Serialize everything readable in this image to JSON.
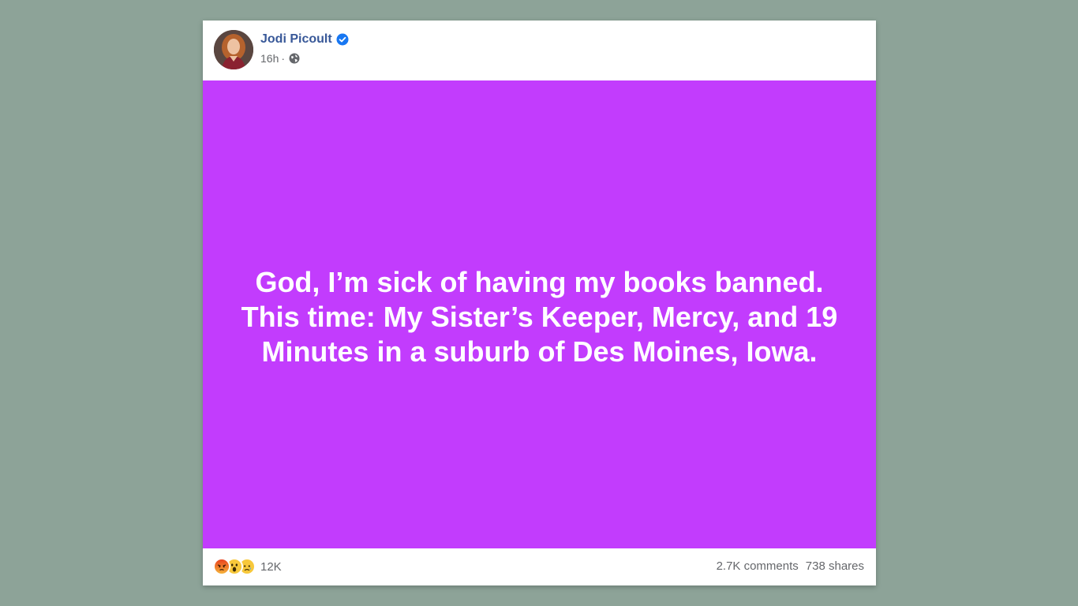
{
  "post": {
    "author": "Jodi Picoult",
    "time": "16h",
    "separator": "·",
    "text": "God, I’m sick of having my books banned. This time: My Sister’s Keeper, Mercy, and 19 Minutes in a suburb of Des Moines, Iowa.",
    "background_color": "#c23cfd"
  },
  "footer": {
    "reactions": [
      "angry-icon",
      "wow-icon",
      "sad-icon"
    ],
    "reaction_count": "12K",
    "comments": "2.7K comments",
    "shares": "738 shares"
  },
  "colors": {
    "page_background": "#8da398",
    "author_link": "#385898",
    "verified": "#1877f2",
    "muted_text": "#65676b"
  }
}
